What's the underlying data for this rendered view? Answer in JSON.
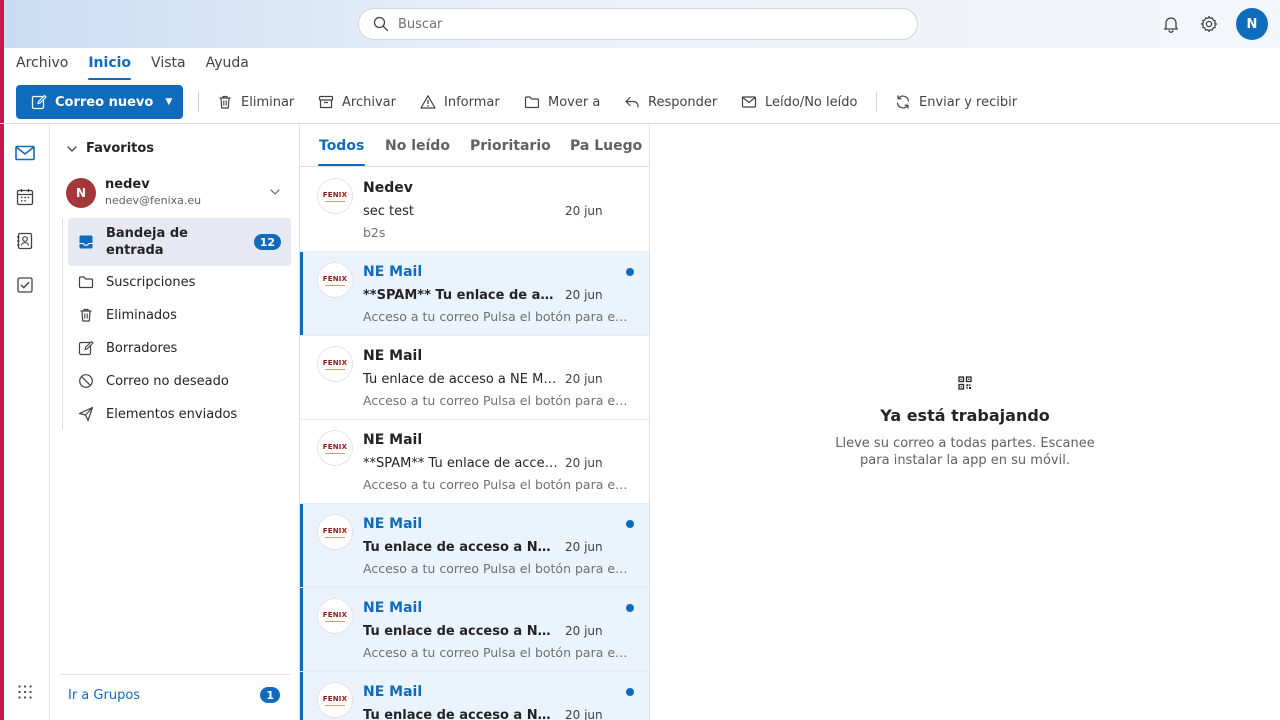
{
  "search": {
    "placeholder": "Buscar"
  },
  "user": {
    "initial": "N"
  },
  "menu": {
    "tabs": [
      {
        "label": "Archivo",
        "active": false
      },
      {
        "label": "Inicio",
        "active": true
      },
      {
        "label": "Vista",
        "active": false
      },
      {
        "label": "Ayuda",
        "active": false
      }
    ]
  },
  "ribbon": {
    "new_mail": "Correo nuevo",
    "delete": "Eliminar",
    "archive": "Archivar",
    "report": "Informar",
    "move": "Mover a",
    "reply": "Responder",
    "read_unread": "Leído/No leído",
    "send_receive": "Enviar y recibir"
  },
  "folders": {
    "favorites": "Favoritos",
    "account": {
      "initial": "N",
      "name": "nedev",
      "email": "nedev@fenixa.eu"
    },
    "items": [
      {
        "label": "Bandeja de entrada",
        "count": "12",
        "icon": "inbox-icon"
      },
      {
        "label": "Suscripciones",
        "icon": "folder-icon"
      },
      {
        "label": "Eliminados",
        "icon": "trash-icon"
      },
      {
        "label": "Borradores",
        "icon": "draft-icon"
      },
      {
        "label": "Correo no deseado",
        "icon": "junk-icon"
      },
      {
        "label": "Elementos enviados",
        "icon": "send-icon"
      }
    ],
    "groups": {
      "label": "Ir a Grupos",
      "count": "1"
    }
  },
  "list": {
    "tabs": [
      "Todos",
      "No leído",
      "Prioritario",
      "Pa Luego"
    ],
    "logo_text": "FENIX",
    "messages": [
      {
        "sender": "Nedev",
        "subject": "sec test",
        "date": "20 jun",
        "preview": "b2s",
        "unread": false
      },
      {
        "sender": "NE Mail",
        "subject": "**SPAM** Tu enlace de acceso a NE Mail",
        "date": "20 jun",
        "preview": "Acceso a tu correo Pulsa el botón para entrar",
        "unread": true
      },
      {
        "sender": "NE Mail",
        "subject": "Tu enlace de acceso a NE Mail",
        "date": "20 jun",
        "preview": "Acceso a tu correo Pulsa el botón para entrar",
        "unread": false
      },
      {
        "sender": "NE Mail",
        "subject": "**SPAM** Tu enlace de acceso a NE Mail",
        "date": "20 jun",
        "preview": "Acceso a tu correo Pulsa el botón para entrar",
        "unread": false
      },
      {
        "sender": "NE Mail",
        "subject": "Tu enlace de acceso a NE Mail",
        "date": "20 jun",
        "preview": "Acceso a tu correo Pulsa el botón para entrar",
        "unread": true
      },
      {
        "sender": "NE Mail",
        "subject": "Tu enlace de acceso a NE Mail",
        "date": "20 jun",
        "preview": "Acceso a tu correo Pulsa el botón para entrar",
        "unread": true
      },
      {
        "sender": "NE Mail",
        "subject": "Tu enlace de acceso a NE Mail",
        "date": "20 jun",
        "preview": "",
        "unread": true
      }
    ]
  },
  "reading": {
    "title": "Ya está trabajando",
    "description": "Lleve su correo a todas partes. Escanee para instalar la app en su móvil."
  },
  "colors": {
    "accent": "#0f6cbd",
    "strip": "#c8174d",
    "avatar": "#a4373a"
  }
}
